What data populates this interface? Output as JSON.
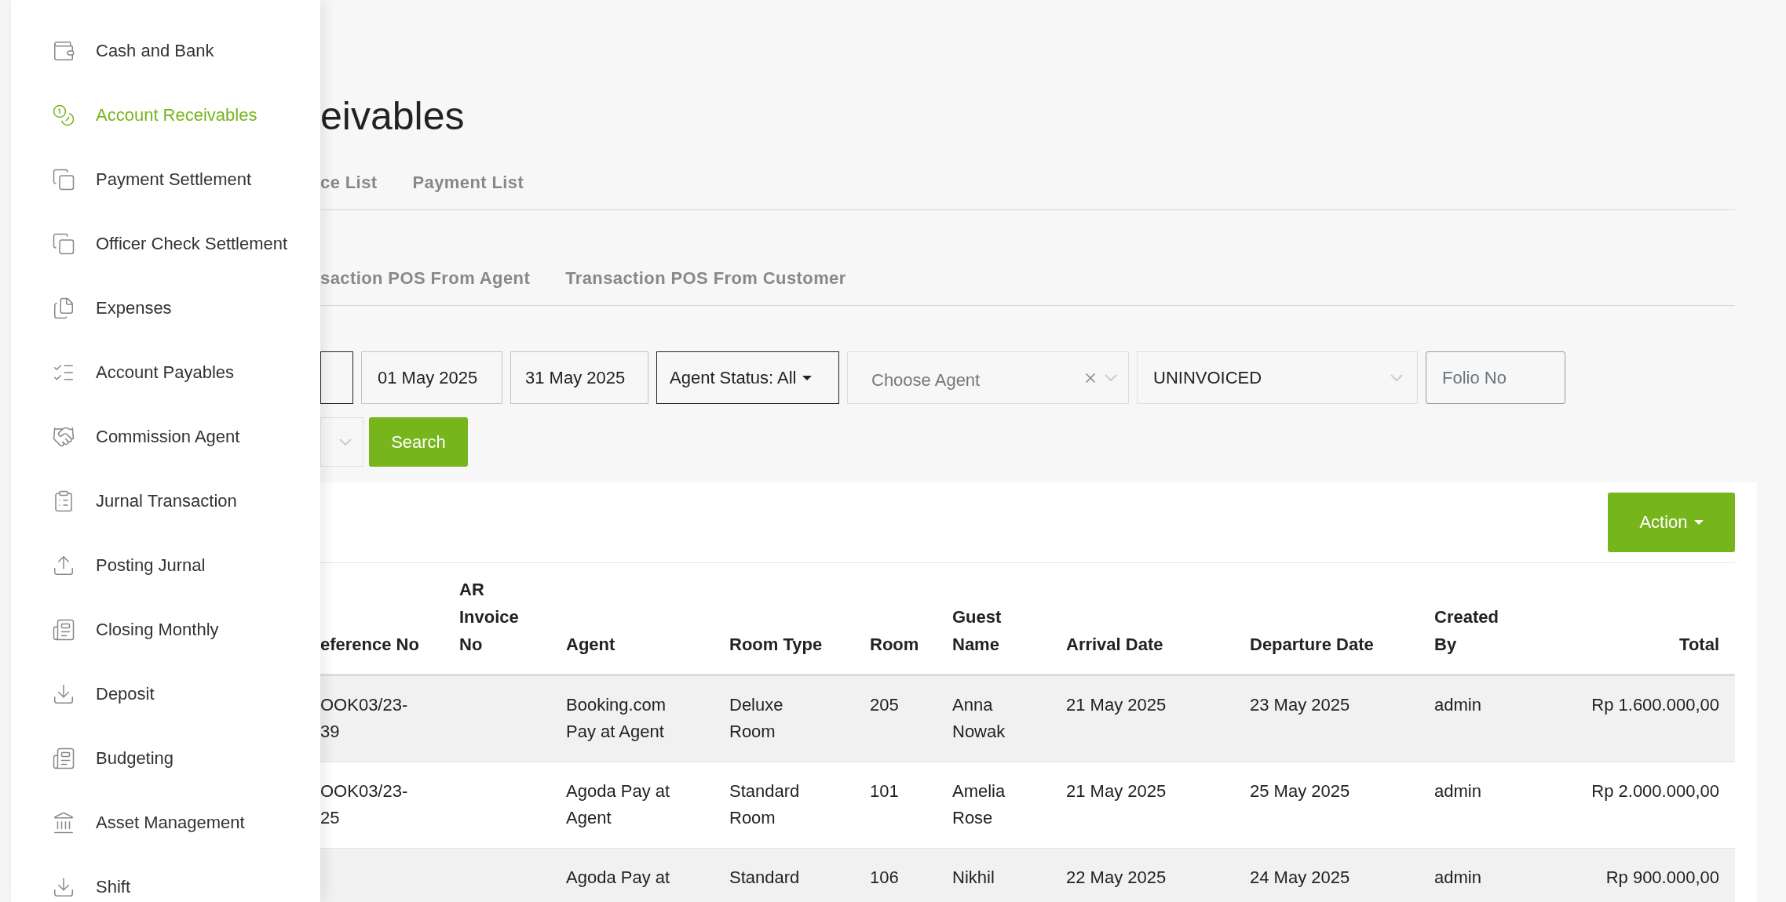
{
  "sidebar": {
    "items": [
      {
        "label": "Cash and Bank",
        "selected": false
      },
      {
        "label": "Account Receivables",
        "selected": true
      },
      {
        "label": "Payment Settlement",
        "selected": false
      },
      {
        "label": "Officer Check Settlement",
        "selected": false
      },
      {
        "label": "Expenses",
        "selected": false
      },
      {
        "label": "Account Payables",
        "selected": false
      },
      {
        "label": "Commission Agent",
        "selected": false
      },
      {
        "label": "Jurnal Transaction",
        "selected": false
      },
      {
        "label": "Posting Jurnal",
        "selected": false
      },
      {
        "label": "Closing Monthly",
        "selected": false
      },
      {
        "label": "Deposit",
        "selected": false
      },
      {
        "label": "Budgeting",
        "selected": false
      },
      {
        "label": "Asset Management",
        "selected": false
      },
      {
        "label": "Shift",
        "selected": false
      }
    ]
  },
  "page_title": "eivables",
  "tabs": [
    {
      "label": "ce List",
      "selected": false
    },
    {
      "label": "Payment List",
      "selected": false
    }
  ],
  "subtabs": [
    {
      "label": "saction POS From Agent",
      "selected": false
    },
    {
      "label": "Transaction POS From Customer",
      "selected": false
    }
  ],
  "filters": {
    "date_from": "01 May 2025",
    "date_to": "31 May 2025",
    "agent_status": "Agent Status: All",
    "agent": {
      "placeholder": "Choose Agent"
    },
    "invoice_status": "UNINVOICED",
    "folio": {
      "placeholder": "Folio No"
    }
  },
  "search_button": "Search",
  "action_button": "Action",
  "table": {
    "columns": [
      "eference No",
      "AR Invoice No",
      "Agent",
      "Room Type",
      "Room",
      "Guest Name",
      "Arrival Date",
      "Departure Date",
      "Created By",
      "Total"
    ],
    "rows": [
      [
        "OOK03/23-39",
        "",
        "Booking.com Pay at Agent",
        "Deluxe Room",
        "205",
        "Anna Nowak",
        "21 May 2025",
        "23 May 2025",
        "admin",
        "Rp 1.600.000,00"
      ],
      [
        "OOK03/23-25",
        "",
        "Agoda Pay at Agent",
        "Standard Room",
        "101",
        "Amelia Rose",
        "21 May 2025",
        "25 May 2025",
        "admin",
        "Rp 2.000.000,00"
      ],
      [
        "",
        "",
        "Agoda Pay at",
        "Standard",
        "106",
        "Nikhil",
        "22 May 2025",
        "24 May 2025",
        "admin",
        "Rp 900.000,00"
      ]
    ]
  }
}
